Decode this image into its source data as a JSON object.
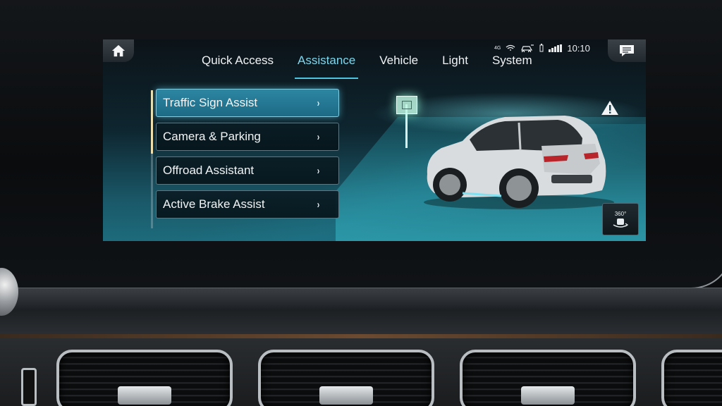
{
  "header": {
    "tabs": [
      {
        "label": "Quick Access",
        "active": false
      },
      {
        "label": "Assistance",
        "active": true
      },
      {
        "label": "Vehicle",
        "active": false
      },
      {
        "label": "Light",
        "active": false
      },
      {
        "label": "System",
        "active": false
      }
    ],
    "status": {
      "network": "4G",
      "time": "10:10"
    }
  },
  "menu": {
    "items": [
      {
        "label": "Traffic Sign Assist",
        "selected": true
      },
      {
        "label": "Camera & Parking",
        "selected": false
      },
      {
        "label": "Offroad Assistant",
        "selected": false
      },
      {
        "label": "Active Brake Assist",
        "selected": false
      }
    ],
    "chevron": "›"
  },
  "camera_button": {
    "label": "360°"
  },
  "colors": {
    "accent": "#7fd6ec",
    "selected_item": "#2c86a2",
    "screen_bg": "#0e2630"
  },
  "icons": [
    "home-icon",
    "message-icon",
    "warning-icon",
    "camera-360-icon",
    "signal-icon",
    "car-icon"
  ]
}
